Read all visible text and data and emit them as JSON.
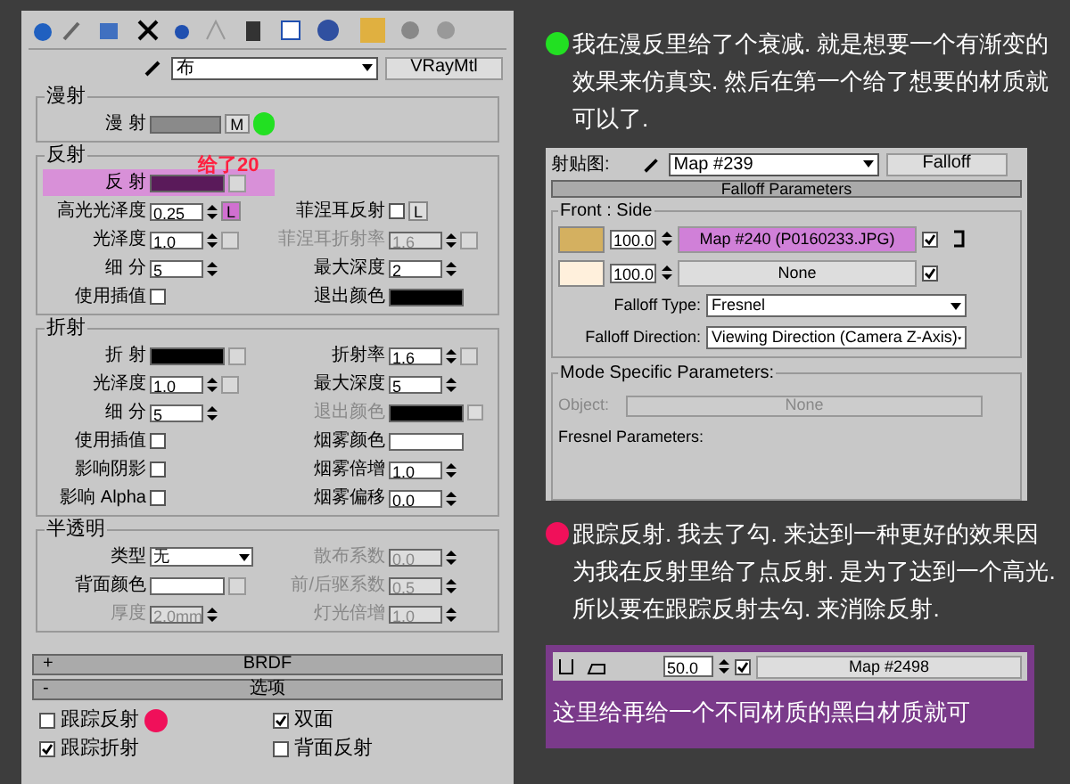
{
  "material": {
    "name": "布",
    "type": "VRayMtl"
  },
  "groups": [
    {
      "title": "漫射",
      "rows": [
        {
          "left": {
            "kind": "color",
            "label": "漫 射",
            "color": "#8a8a8a",
            "map_label": "M",
            "marker": {
              "color": "#22e022"
            }
          }
        }
      ]
    },
    {
      "title": "反射",
      "annotation": "给了20",
      "rows": [
        {
          "left": {
            "kind": "color",
            "label": "反 射",
            "color": "#5a1a5a",
            "has_map_button": true,
            "highlighted": true
          }
        },
        {
          "left": {
            "kind": "spinner",
            "label": "高光光泽度",
            "value": "0.25",
            "lock": "L",
            "lock_highlighted": true
          },
          "right": {
            "kind": "check",
            "label": "菲涅耳反射",
            "checked": false,
            "lock": "L"
          }
        },
        {
          "left": {
            "kind": "spinner",
            "label": "光泽度",
            "value": "1.0",
            "has_map_button": true
          },
          "right": {
            "kind": "spinner",
            "label": "菲涅耳折射率",
            "value": "1.6",
            "disabled": true,
            "has_map_button": true
          }
        },
        {
          "left": {
            "kind": "spinner",
            "label": "细 分",
            "value": "5"
          },
          "right": {
            "kind": "spinner",
            "label": "最大深度",
            "value": "2"
          }
        },
        {
          "left": {
            "kind": "check",
            "label": "使用插值",
            "checked": false
          },
          "right": {
            "kind": "color",
            "label": "退出颜色",
            "color": "#000000"
          }
        }
      ]
    },
    {
      "title": "折射",
      "rows": [
        {
          "left": {
            "kind": "color",
            "label": "折 射",
            "color": "#000000",
            "has_map_button": true
          },
          "right": {
            "kind": "spinner",
            "label": "折射率",
            "value": "1.6",
            "has_map_button": true
          }
        },
        {
          "left": {
            "kind": "spinner",
            "label": "光泽度",
            "value": "1.0",
            "has_map_button": true
          },
          "right": {
            "kind": "spinner",
            "label": "最大深度",
            "value": "5"
          }
        },
        {
          "left": {
            "kind": "spinner",
            "label": "细 分",
            "value": "5"
          },
          "right": {
            "kind": "color",
            "label": "退出颜色",
            "color": "#000000",
            "disabled": true,
            "check": false
          }
        },
        {
          "left": {
            "kind": "check",
            "label": "使用插值",
            "checked": false
          },
          "right": {
            "kind": "color",
            "label": "烟雾颜色",
            "color": "#ffffff"
          }
        },
        {
          "left": {
            "kind": "check",
            "label": "影响阴影",
            "checked": false
          },
          "right": {
            "kind": "spinner",
            "label": "烟雾倍增",
            "value": "1.0"
          }
        },
        {
          "left": {
            "kind": "check",
            "label": "影响 Alpha",
            "checked": false
          },
          "right": {
            "kind": "spinner",
            "label": "烟雾偏移",
            "value": "0.0"
          }
        }
      ]
    },
    {
      "title": "半透明",
      "rows": [
        {
          "left": {
            "kind": "select",
            "label": "类型",
            "value": "无"
          },
          "right": {
            "kind": "spinner",
            "label": "散布系数",
            "value": "0.0",
            "disabled": true
          }
        },
        {
          "left": {
            "kind": "color",
            "label": "背面颜色",
            "color": "#ffffff",
            "has_map_button": true
          },
          "right": {
            "kind": "spinner",
            "label": "前/后驱系数",
            "value": "0.5",
            "disabled": true
          }
        },
        {
          "left": {
            "kind": "spinner",
            "label": "厚度",
            "value": "2.0mm",
            "disabled": true
          },
          "right": {
            "kind": "spinner",
            "label": "灯光倍增",
            "value": "1.0",
            "disabled": true
          }
        }
      ]
    }
  ],
  "rollouts": [
    {
      "sign": "+",
      "title": "BRDF"
    },
    {
      "sign": "-",
      "title": "选项"
    }
  ],
  "options": [
    {
      "label": "跟踪反射",
      "checked": false,
      "marker": {
        "color": "#f0105a"
      }
    },
    {
      "label": "双面",
      "checked": true
    },
    {
      "label": "跟踪折射",
      "checked": true
    },
    {
      "label": "背面反射",
      "checked": false
    }
  ],
  "notes": [
    {
      "color": "#22e022",
      "text": "我在漫反里给了个衰减. 就是想要一个有渐变的效果来仿真实. 然后在第一个给了想要的材质就可以了."
    },
    {
      "color": "#f0105a",
      "text": "跟踪反射. 我去了勾. 来达到一种更好的效果因为我在反射里给了点反射. 是为了达到一个高光. 所以要在跟踪反射去勾. 来消除反射."
    }
  ],
  "falloff": {
    "slot_label": "射贴图:",
    "map_name": "Map #239",
    "map_type": "Falloff",
    "rollout_title": "Falloff Parameters",
    "group_title": "Front : Side",
    "slots": [
      {
        "color": "#d4b060",
        "amount": "100.0",
        "map": "Map #240 (P0160233.JPG)",
        "highlighted": true,
        "checked": true
      },
      {
        "color": "#fff0dc",
        "amount": "100.0",
        "map": "None",
        "highlighted": false,
        "checked": true
      }
    ],
    "fields": [
      {
        "label": "Falloff Type:",
        "value": "Fresnel"
      },
      {
        "label": "Falloff Direction:",
        "value": "Viewing Direction (Camera Z-Axis)"
      }
    ],
    "mode_title": "Mode Specific Parameters:",
    "object_label": "Object:",
    "object_value": "None",
    "fresnel_title": "Fresnel Parameters:"
  },
  "bottom": {
    "amount": "50.0",
    "checked": true,
    "map": "Map #2498",
    "caption": "这里给再给一个不同材质的黑白材质就可"
  }
}
